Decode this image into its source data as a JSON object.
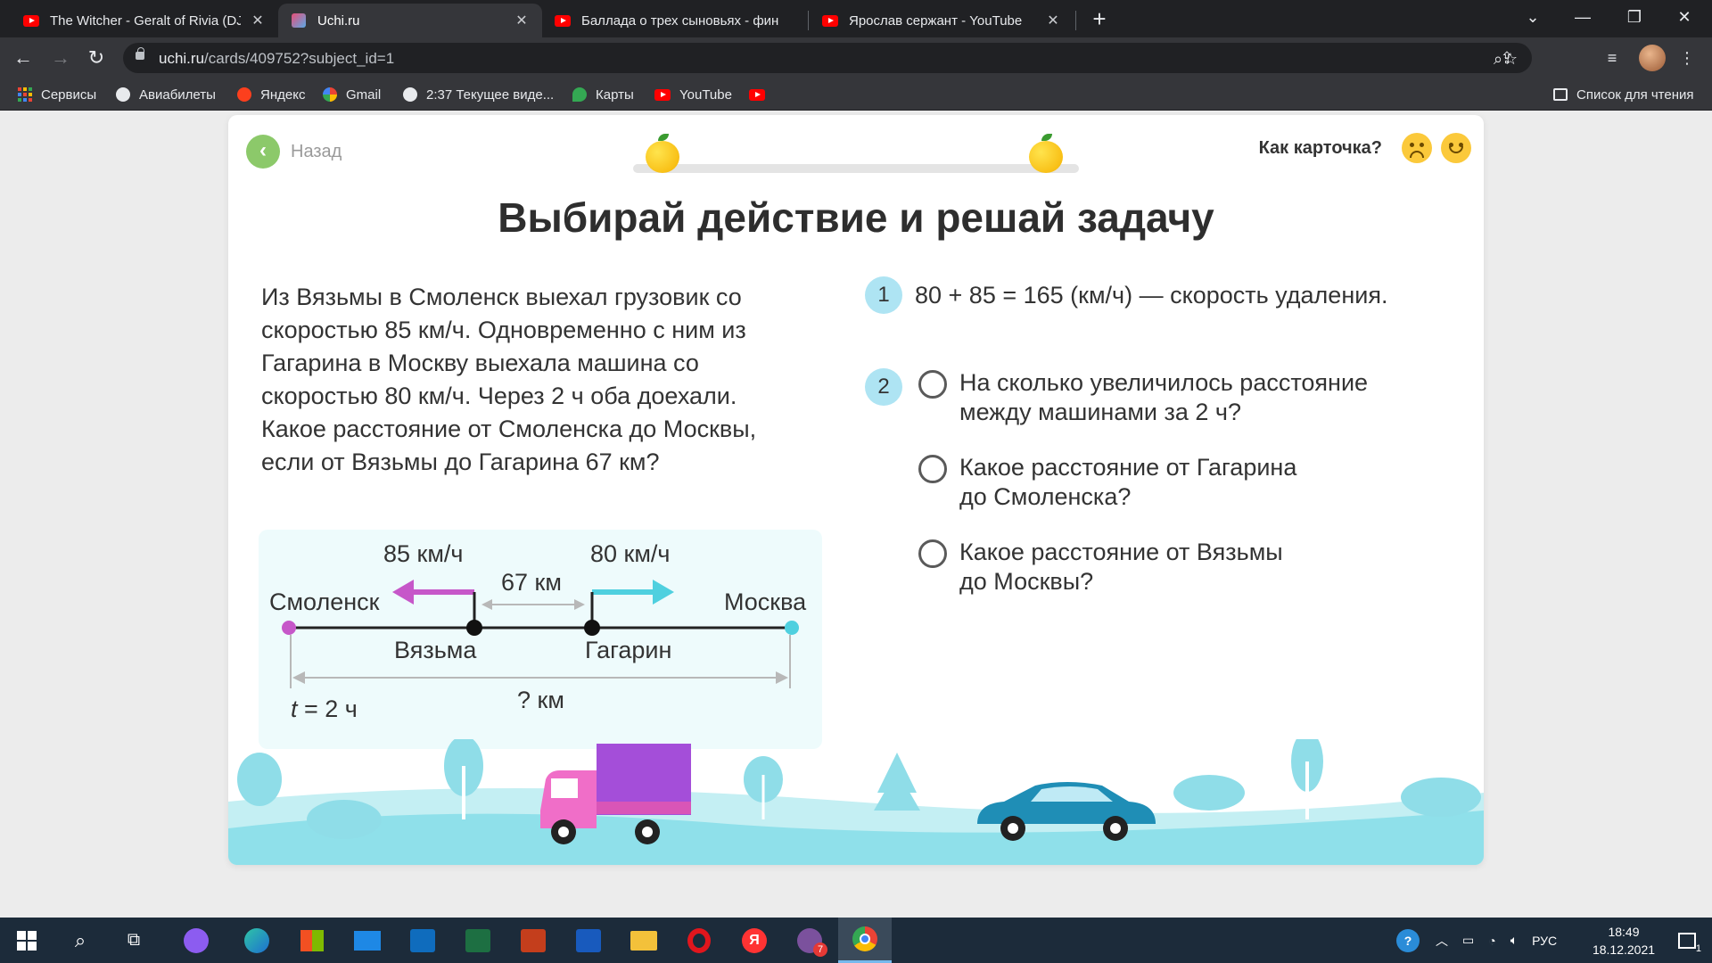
{
  "browser": {
    "tabs": [
      {
        "title": "The Witcher - Geralt of Rivia (DJ"
      },
      {
        "title": "Uchi.ru"
      },
      {
        "title": "Баллада о трех сыновьях - фин"
      },
      {
        "title": "Ярослав сержант - YouTube"
      }
    ],
    "url_host": "uchi.ru",
    "url_path": "/cards/409752?subject_id=1",
    "bookmarks": [
      {
        "label": "Сервисы"
      },
      {
        "label": "Авиабилеты"
      },
      {
        "label": "Яндекс"
      },
      {
        "label": "Gmail"
      },
      {
        "label": "2:37 Текущее виде..."
      },
      {
        "label": "Карты"
      },
      {
        "label": "YouTube"
      }
    ],
    "reading_list": "Список для чтения"
  },
  "card": {
    "back_label": "Назад",
    "rate_question": "Как карточка?",
    "title": "Выбирай действие и решай задачу",
    "problem_lines": [
      "Из Вязьмы в Смоленск выехал грузовик со",
      "скоростью 85 км/ч. Одновременно с ним из",
      "Гагарина в Москву выехала машина со",
      "скоростью 80 км/ч. Через 2 ч оба доехали.",
      "Какое расстояние от Смоленска до Москвы,",
      "если от Вязьмы до Гагарина 67 км?"
    ],
    "diagram": {
      "speed_left": "85 км/ч",
      "speed_right": "80 км/ч",
      "middle_distance": "67 км",
      "city_left": "Смоленск",
      "city_right": "Москва",
      "point_left": "Вязьма",
      "point_right": "Гагарин",
      "time_var": "t",
      "time_value": " = 2 ч",
      "total_distance": "? км"
    },
    "step1": {
      "number": "1",
      "text": "80 + 85 = 165 (км/ч) — скорость удаления."
    },
    "step2": {
      "number": "2",
      "options": [
        {
          "line1": "На сколько увеличилось расстояние",
          "line2": "между машинами за 2 ч?"
        },
        {
          "line1": "Какое расстояние от Гагарина",
          "line2": "до Смоленска?"
        },
        {
          "line1": "Какое расстояние от Вязьмы",
          "line2": "до Москвы?"
        }
      ]
    }
  },
  "taskbar": {
    "language": "РУС",
    "time": "18:49",
    "date": "18.12.2021",
    "mail_badge": "7",
    "notifications": "1"
  },
  "colors": {
    "accent_green": "#8cc96a",
    "step_circle": "#aee4f3",
    "arrow_magenta": "#c657c9",
    "arrow_cyan": "#4fd0df"
  }
}
